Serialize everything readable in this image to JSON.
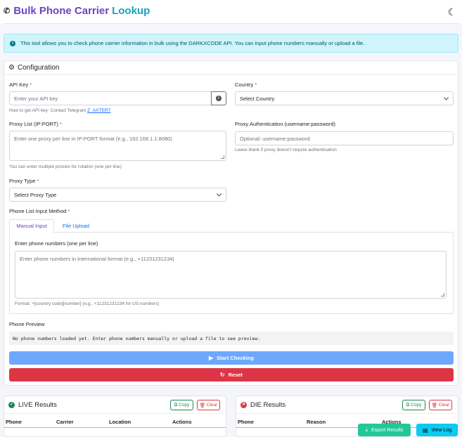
{
  "header": {
    "title_part1": "Bulk Phone Carrier",
    "title_part2": "Lookup",
    "logo_icon": "phone-icon",
    "theme_toggle_icon": "moon-icon"
  },
  "alert": {
    "text": "This tool allows you to check phone carrier information in bulk using the DARKXCODE API. You can input phone numbers manually or upload a file."
  },
  "config": {
    "title": "Configuration",
    "api_key": {
      "label": "API Key",
      "placeholder": "Enter your API key",
      "help": "How to get API key: Contact Telegram",
      "help_link": "Z_AXTERT"
    },
    "country": {
      "label": "Country",
      "value": "Select Country"
    },
    "proxy_list": {
      "label": "Proxy List (IP:PORT)",
      "placeholder": "Enter one proxy per line in IP:PORT format (e.g., 192.168.1.1:8080)",
      "help": "You can enter multiple proxies for rotation (one per line)"
    },
    "proxy_auth": {
      "label": "Proxy Authentication (username:password)",
      "placeholder": "Optional: username:password",
      "help": "Leave blank if proxy doesn't require authentication"
    },
    "proxy_type": {
      "label": "Proxy Type",
      "value": "Select Proxy Type"
    },
    "input_method": {
      "label": "Phone List Input Method",
      "tabs": [
        "Manual Input",
        "File Upload"
      ]
    },
    "phones": {
      "label": "Enter phone numbers (one per line)",
      "placeholder": "Enter phone numbers in international format (e.g., +11231231234)",
      "help": "Format: +[country code][number] (e.g., +11231231234 for US numbers)"
    },
    "preview": {
      "label": "Phone Preview",
      "text": "No phone numbers loaded yet. Enter phone numbers manually or upload a file to see preview."
    },
    "start_label": "Start Checking",
    "reset_label": "Reset"
  },
  "live": {
    "title": "LIVE Results",
    "copy_label": "Copy",
    "clear_label": "Clear",
    "columns": [
      "Phone",
      "Carrier",
      "Location",
      "Actions"
    ]
  },
  "die": {
    "title": "DIE Results",
    "copy_label": "Copy",
    "clear_label": "Clear",
    "columns": [
      "Phone",
      "Reason",
      "Actions"
    ]
  },
  "floating": {
    "export_label": "Export Results",
    "log_label": "View Log"
  },
  "colors": {
    "title_purple": "#6f42c1",
    "title_teal": "#17a2b8",
    "primary": "#6ea8fe",
    "danger": "#dc3545",
    "success": "#198754",
    "export": "#20c997",
    "info": "#0dcaf0"
  }
}
